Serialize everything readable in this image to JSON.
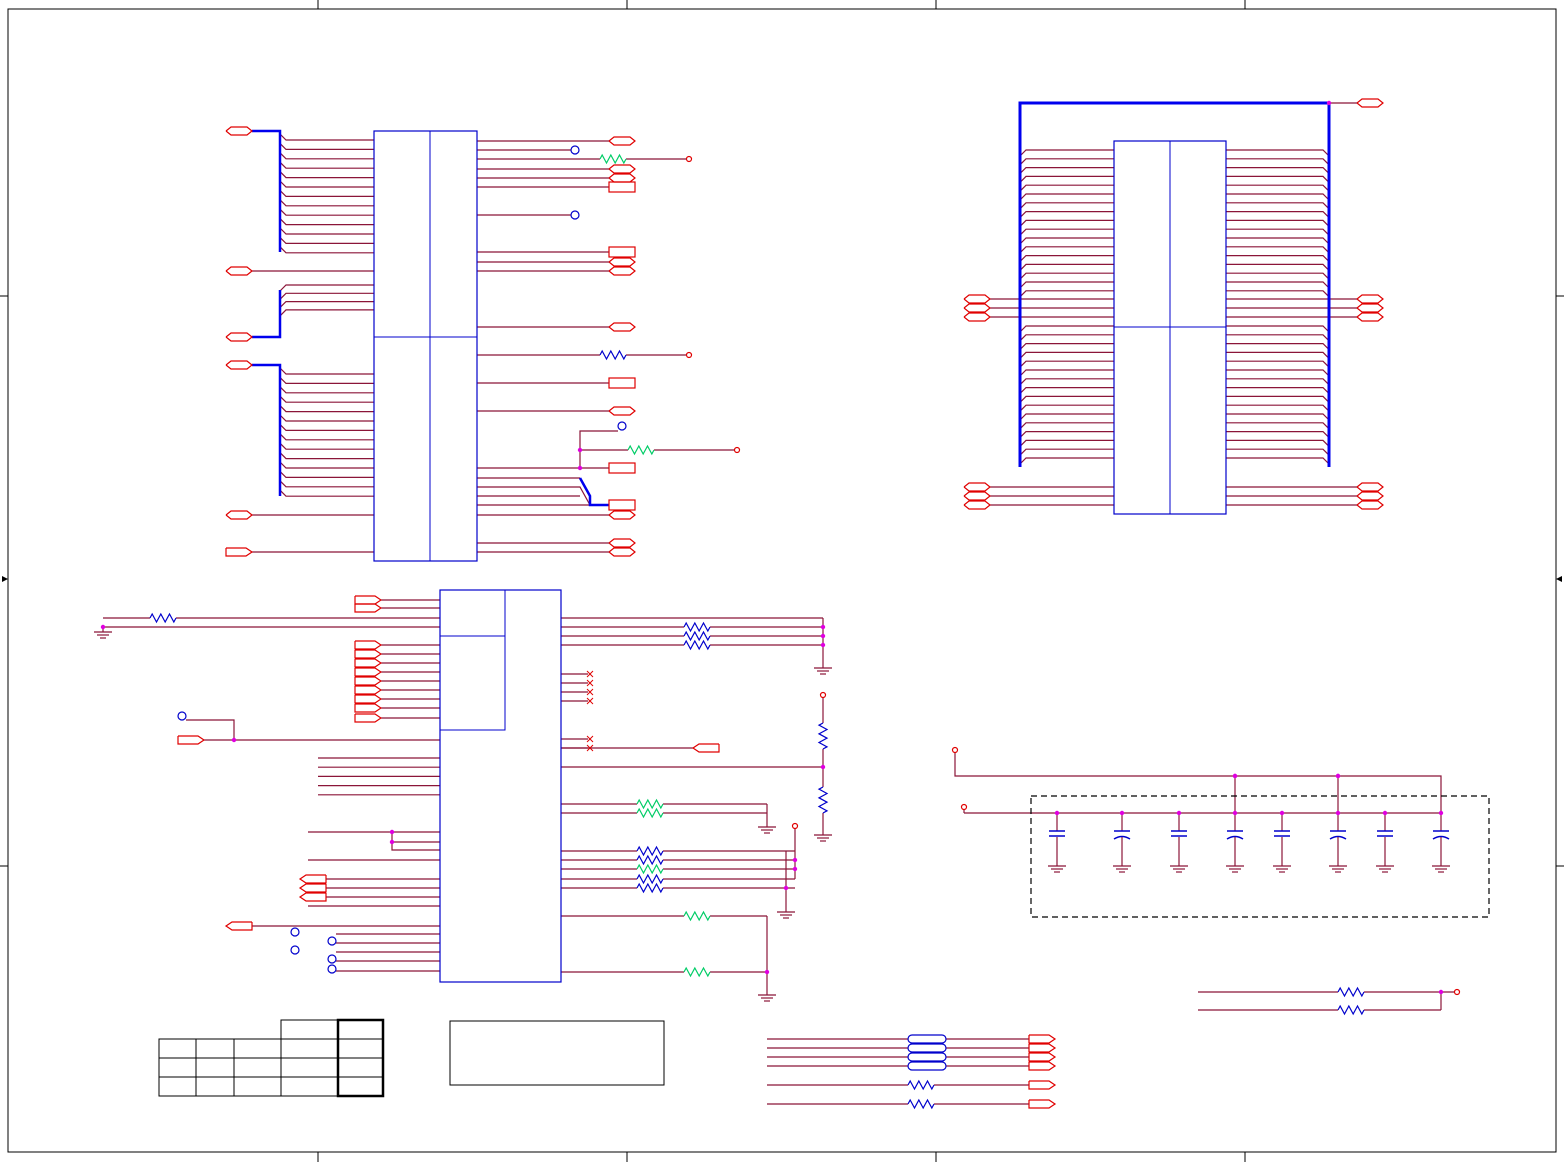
{
  "sheet": {
    "colors": {
      "wire": "#8b1538",
      "bus": "#0000ee",
      "port": "#e00000",
      "component": "#0000cc",
      "junction": "#e000e0",
      "highlight": "#00cc66",
      "frame": "#000000",
      "dash": "#000000"
    },
    "icons": [
      "resistor-icon",
      "capacitor-icon",
      "ground-icon",
      "port-icon",
      "ferrite-bead-icon",
      "no-connect-icon",
      "junction-dot-icon"
    ]
  }
}
